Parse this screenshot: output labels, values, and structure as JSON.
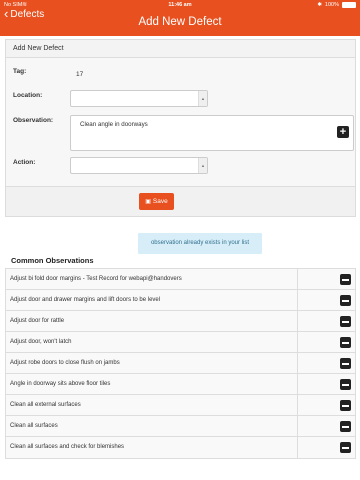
{
  "status_bar": {
    "carrier": "No SIM",
    "time": "11:46 am",
    "battery": "100%",
    "battery_level": 1.0
  },
  "nav": {
    "back_label": "Defects",
    "title": "Add New Defect"
  },
  "form": {
    "header": "Add New Defect",
    "tag_label": "Tag:",
    "tag_value": "17",
    "location_label": "Location:",
    "location_value": "",
    "observation_label": "Observation:",
    "observation_value": "Clean angle in doorways",
    "action_label": "Action:",
    "action_value": "",
    "save_label": "Save"
  },
  "alert": {
    "message": "observation already exists in your list"
  },
  "common_observations": {
    "title": "Common Observations",
    "items": [
      "Adjust bi fold door margins - Test Record for webapi@handovers",
      "Adjust door and drawer margins and lift doors to be level",
      "Adjust door for rattle",
      "Adjust door, won't latch",
      "Adjust robe doors to close flush on jambs",
      "Angle in doorway sits above floor tiles",
      "Clean all external surfaces",
      "Clean all surfaces",
      "Clean all surfaces and check for blemishes"
    ]
  },
  "colors": {
    "accent": "#e8501f",
    "alert_bg": "#d7eef8",
    "alert_text": "#31708f"
  },
  "icons": [
    "back-chevron-icon",
    "wifi-icon",
    "bluetooth-icon",
    "battery-icon",
    "dropdown-arrow-icon",
    "plus-icon",
    "save-disk-icon",
    "minus-icon"
  ]
}
